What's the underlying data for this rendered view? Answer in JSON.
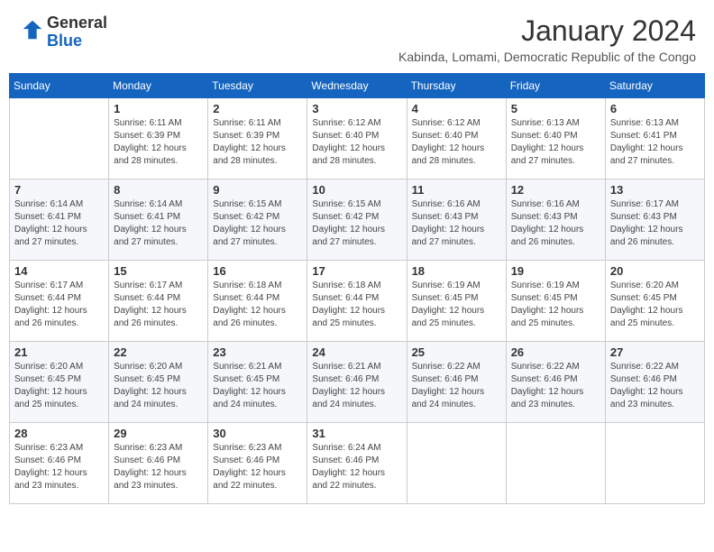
{
  "logo": {
    "general": "General",
    "blue": "Blue"
  },
  "header": {
    "title": "January 2024",
    "location": "Kabinda, Lomami, Democratic Republic of the Congo"
  },
  "weekdays": [
    "Sunday",
    "Monday",
    "Tuesday",
    "Wednesday",
    "Thursday",
    "Friday",
    "Saturday"
  ],
  "weeks": [
    [
      {
        "day": "",
        "info": ""
      },
      {
        "day": "1",
        "info": "Sunrise: 6:11 AM\nSunset: 6:39 PM\nDaylight: 12 hours and 28 minutes."
      },
      {
        "day": "2",
        "info": "Sunrise: 6:11 AM\nSunset: 6:39 PM\nDaylight: 12 hours and 28 minutes."
      },
      {
        "day": "3",
        "info": "Sunrise: 6:12 AM\nSunset: 6:40 PM\nDaylight: 12 hours and 28 minutes."
      },
      {
        "day": "4",
        "info": "Sunrise: 6:12 AM\nSunset: 6:40 PM\nDaylight: 12 hours and 28 minutes."
      },
      {
        "day": "5",
        "info": "Sunrise: 6:13 AM\nSunset: 6:40 PM\nDaylight: 12 hours and 27 minutes."
      },
      {
        "day": "6",
        "info": "Sunrise: 6:13 AM\nSunset: 6:41 PM\nDaylight: 12 hours and 27 minutes."
      }
    ],
    [
      {
        "day": "7",
        "info": "Sunrise: 6:14 AM\nSunset: 6:41 PM\nDaylight: 12 hours and 27 minutes."
      },
      {
        "day": "8",
        "info": "Sunrise: 6:14 AM\nSunset: 6:41 PM\nDaylight: 12 hours and 27 minutes."
      },
      {
        "day": "9",
        "info": "Sunrise: 6:15 AM\nSunset: 6:42 PM\nDaylight: 12 hours and 27 minutes."
      },
      {
        "day": "10",
        "info": "Sunrise: 6:15 AM\nSunset: 6:42 PM\nDaylight: 12 hours and 27 minutes."
      },
      {
        "day": "11",
        "info": "Sunrise: 6:16 AM\nSunset: 6:43 PM\nDaylight: 12 hours and 27 minutes."
      },
      {
        "day": "12",
        "info": "Sunrise: 6:16 AM\nSunset: 6:43 PM\nDaylight: 12 hours and 26 minutes."
      },
      {
        "day": "13",
        "info": "Sunrise: 6:17 AM\nSunset: 6:43 PM\nDaylight: 12 hours and 26 minutes."
      }
    ],
    [
      {
        "day": "14",
        "info": "Sunrise: 6:17 AM\nSunset: 6:44 PM\nDaylight: 12 hours and 26 minutes."
      },
      {
        "day": "15",
        "info": "Sunrise: 6:17 AM\nSunset: 6:44 PM\nDaylight: 12 hours and 26 minutes."
      },
      {
        "day": "16",
        "info": "Sunrise: 6:18 AM\nSunset: 6:44 PM\nDaylight: 12 hours and 26 minutes."
      },
      {
        "day": "17",
        "info": "Sunrise: 6:18 AM\nSunset: 6:44 PM\nDaylight: 12 hours and 25 minutes."
      },
      {
        "day": "18",
        "info": "Sunrise: 6:19 AM\nSunset: 6:45 PM\nDaylight: 12 hours and 25 minutes."
      },
      {
        "day": "19",
        "info": "Sunrise: 6:19 AM\nSunset: 6:45 PM\nDaylight: 12 hours and 25 minutes."
      },
      {
        "day": "20",
        "info": "Sunrise: 6:20 AM\nSunset: 6:45 PM\nDaylight: 12 hours and 25 minutes."
      }
    ],
    [
      {
        "day": "21",
        "info": "Sunrise: 6:20 AM\nSunset: 6:45 PM\nDaylight: 12 hours and 25 minutes."
      },
      {
        "day": "22",
        "info": "Sunrise: 6:20 AM\nSunset: 6:45 PM\nDaylight: 12 hours and 24 minutes."
      },
      {
        "day": "23",
        "info": "Sunrise: 6:21 AM\nSunset: 6:45 PM\nDaylight: 12 hours and 24 minutes."
      },
      {
        "day": "24",
        "info": "Sunrise: 6:21 AM\nSunset: 6:46 PM\nDaylight: 12 hours and 24 minutes."
      },
      {
        "day": "25",
        "info": "Sunrise: 6:22 AM\nSunset: 6:46 PM\nDaylight: 12 hours and 24 minutes."
      },
      {
        "day": "26",
        "info": "Sunrise: 6:22 AM\nSunset: 6:46 PM\nDaylight: 12 hours and 23 minutes."
      },
      {
        "day": "27",
        "info": "Sunrise: 6:22 AM\nSunset: 6:46 PM\nDaylight: 12 hours and 23 minutes."
      }
    ],
    [
      {
        "day": "28",
        "info": "Sunrise: 6:23 AM\nSunset: 6:46 PM\nDaylight: 12 hours and 23 minutes."
      },
      {
        "day": "29",
        "info": "Sunrise: 6:23 AM\nSunset: 6:46 PM\nDaylight: 12 hours and 23 minutes."
      },
      {
        "day": "30",
        "info": "Sunrise: 6:23 AM\nSunset: 6:46 PM\nDaylight: 12 hours and 22 minutes."
      },
      {
        "day": "31",
        "info": "Sunrise: 6:24 AM\nSunset: 6:46 PM\nDaylight: 12 hours and 22 minutes."
      },
      {
        "day": "",
        "info": ""
      },
      {
        "day": "",
        "info": ""
      },
      {
        "day": "",
        "info": ""
      }
    ]
  ]
}
